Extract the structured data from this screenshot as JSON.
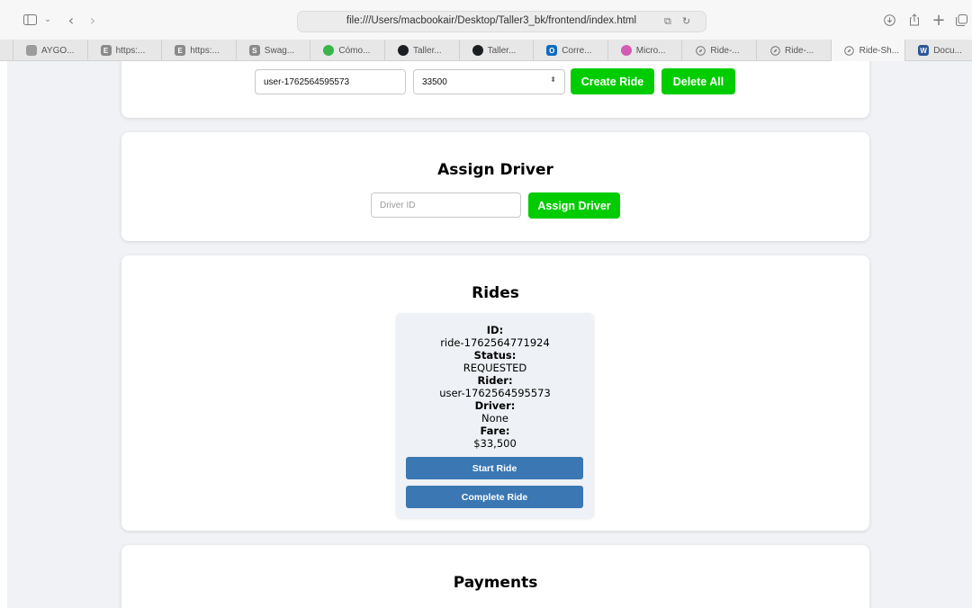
{
  "browser": {
    "url": "file:///Users/macbookair/Desktop/Taller3_bk/frontend/index.html",
    "tabs": [
      {
        "label": "AYGO...",
        "favicon": "site-icon",
        "color": "#9c9c9c",
        "glyph": ""
      },
      {
        "label": "https:...",
        "favicon": "e-icon",
        "color": "#8a8a8a",
        "glyph": "E"
      },
      {
        "label": "https:...",
        "favicon": "e-icon",
        "color": "#8a8a8a",
        "glyph": "E"
      },
      {
        "label": "Swag...",
        "favicon": "s-icon",
        "color": "#8a8a8a",
        "glyph": "S"
      },
      {
        "label": "Cómo...",
        "favicon": "green-circle-icon",
        "color": "#39b54a",
        "glyph": ""
      },
      {
        "label": "Taller...",
        "favicon": "github-icon",
        "color": "#1b1f23",
        "glyph": ""
      },
      {
        "label": "Taller...",
        "favicon": "github-icon",
        "color": "#1b1f23",
        "glyph": ""
      },
      {
        "label": "Corre...",
        "favicon": "outlook-icon",
        "color": "#0f6cbd",
        "glyph": "O"
      },
      {
        "label": "Micro...",
        "favicon": "copilot-icon",
        "color": "#d35cb3",
        "glyph": ""
      },
      {
        "label": "Ride-...",
        "favicon": "compass-icon",
        "color": "",
        "glyph": ""
      },
      {
        "label": "Ride-...",
        "favicon": "compass-icon",
        "color": "",
        "glyph": ""
      },
      {
        "label": "Ride-Sh...",
        "favicon": "compass-icon",
        "color": "",
        "glyph": ""
      },
      {
        "label": "Docu...",
        "favicon": "word-icon",
        "color": "#2b579a",
        "glyph": "W"
      }
    ]
  },
  "create_ride": {
    "rider_value": "user-1762564595573",
    "fare_value": "33500",
    "create_label": "Create Ride",
    "delete_label": "Delete All"
  },
  "assign_driver": {
    "title": "Assign Driver",
    "driver_placeholder": "Driver ID",
    "button_label": "Assign Driver"
  },
  "rides": {
    "title": "Rides",
    "items": [
      {
        "id_label": "ID:",
        "id": "ride-1762564771924",
        "status_label": "Status:",
        "status": "REQUESTED",
        "rider_label": "Rider:",
        "rider": "user-1762564595573",
        "driver_label": "Driver:",
        "driver": "None",
        "fare_label": "Fare:",
        "fare": "$33,500",
        "start_label": "Start Ride",
        "complete_label": "Complete Ride"
      }
    ]
  },
  "payments": {
    "title": "Payments"
  },
  "colors": {
    "primary_green": "#00cc00",
    "action_blue": "#3a77b3",
    "page_bg": "#f0f2f5"
  }
}
